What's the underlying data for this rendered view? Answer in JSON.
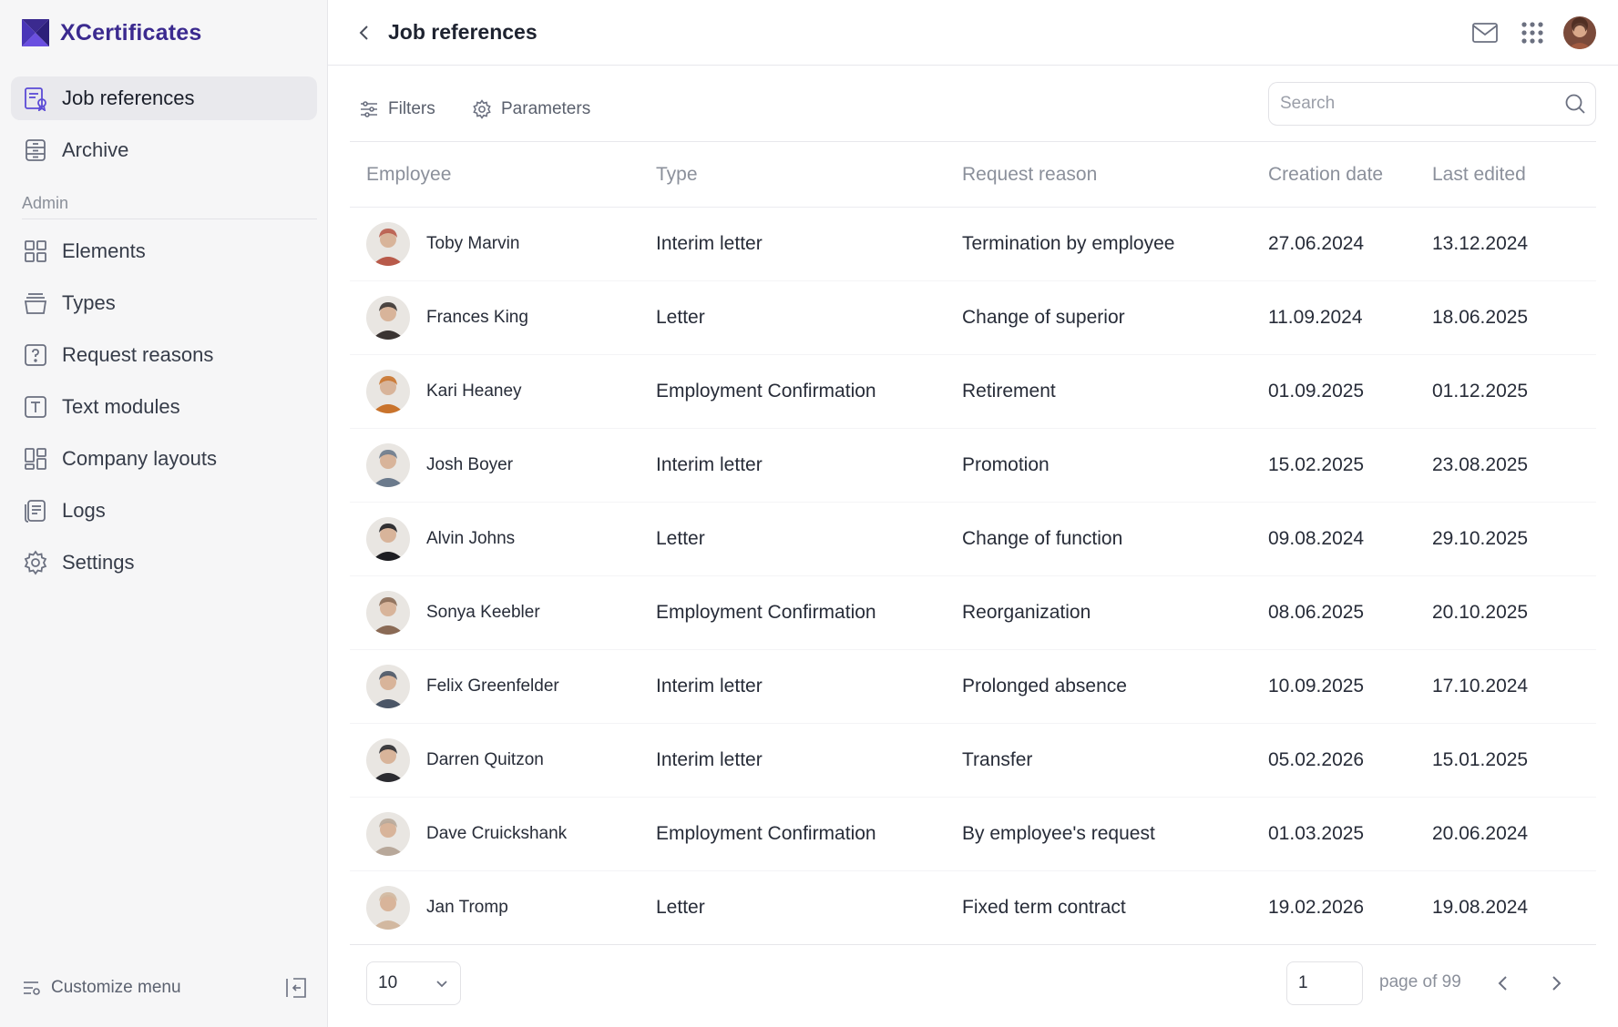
{
  "app": {
    "name": "XCertificates"
  },
  "colors": {
    "brand": "#3b2a8f",
    "active_bg": "#e9e9ed"
  },
  "sidebar": {
    "items": [
      {
        "label": "Job references",
        "icon": "job-reference-icon",
        "active": true
      },
      {
        "label": "Archive",
        "icon": "archive-icon",
        "active": false
      }
    ],
    "admin_label": "Admin",
    "admin_items": [
      {
        "label": "Elements",
        "icon": "grid-icon"
      },
      {
        "label": "Types",
        "icon": "stack-icon"
      },
      {
        "label": "Request reasons",
        "icon": "question-icon"
      },
      {
        "label": "Text modules",
        "icon": "text-icon"
      },
      {
        "label": "Company layouts",
        "icon": "layout-icon"
      },
      {
        "label": "Logs",
        "icon": "logs-icon"
      },
      {
        "label": "Settings",
        "icon": "gear-icon"
      }
    ],
    "customize_label": "Customize menu"
  },
  "header": {
    "title": "Job references"
  },
  "toolbar": {
    "filters_label": "Filters",
    "parameters_label": "Parameters",
    "search_placeholder": "Search"
  },
  "table": {
    "columns": [
      "Employee",
      "Type",
      "Request reason",
      "Creation date",
      "Last edited"
    ],
    "rows": [
      {
        "name": "Toby Marvin",
        "type": "Interim letter",
        "reason": "Termination by employee",
        "created": "27.06.2024",
        "edited": "13.12.2024",
        "avatar_color": "#b85a4a"
      },
      {
        "name": "Frances King",
        "type": "Letter",
        "reason": "Change of superior",
        "created": "11.09.2024",
        "edited": "18.06.2025",
        "avatar_color": "#3a3432"
      },
      {
        "name": "Kari Heaney",
        "type": "Employment Confirmation",
        "reason": "Retirement",
        "created": "01.09.2025",
        "edited": "01.12.2025",
        "avatar_color": "#c9732c"
      },
      {
        "name": "Josh Boyer",
        "type": "Interim letter",
        "reason": "Promotion",
        "created": "15.02.2025",
        "edited": "23.08.2025",
        "avatar_color": "#6b7a8c"
      },
      {
        "name": "Alvin Johns",
        "type": "Letter",
        "reason": "Change of function",
        "created": "09.08.2024",
        "edited": "29.10.2025",
        "avatar_color": "#1e1e22"
      },
      {
        "name": "Sonya Keebler",
        "type": "Employment Confirmation",
        "reason": "Reorganization",
        "created": "08.06.2025",
        "edited": "20.10.2025",
        "avatar_color": "#8a6a55"
      },
      {
        "name": "Felix Greenfelder",
        "type": "Interim letter",
        "reason": "Prolonged absence",
        "created": "10.09.2025",
        "edited": "17.10.2024",
        "avatar_color": "#4a5566"
      },
      {
        "name": "Darren Quitzon",
        "type": "Interim letter",
        "reason": "Transfer",
        "created": "05.02.2026",
        "edited": "15.01.2025",
        "avatar_color": "#2b2b30"
      },
      {
        "name": "Dave Cruickshank",
        "type": "Employment Confirmation",
        "reason": "By employee's request",
        "created": "01.03.2025",
        "edited": "20.06.2024",
        "avatar_color": "#b8a89a"
      },
      {
        "name": "Jan Tromp",
        "type": "Letter",
        "reason": "Fixed term contract",
        "created": "19.02.2026",
        "edited": "19.08.2024",
        "avatar_color": "#d2b8a0"
      }
    ]
  },
  "pagination": {
    "page_size": "10",
    "current_page": "1",
    "page_of_label": "page of 99"
  }
}
